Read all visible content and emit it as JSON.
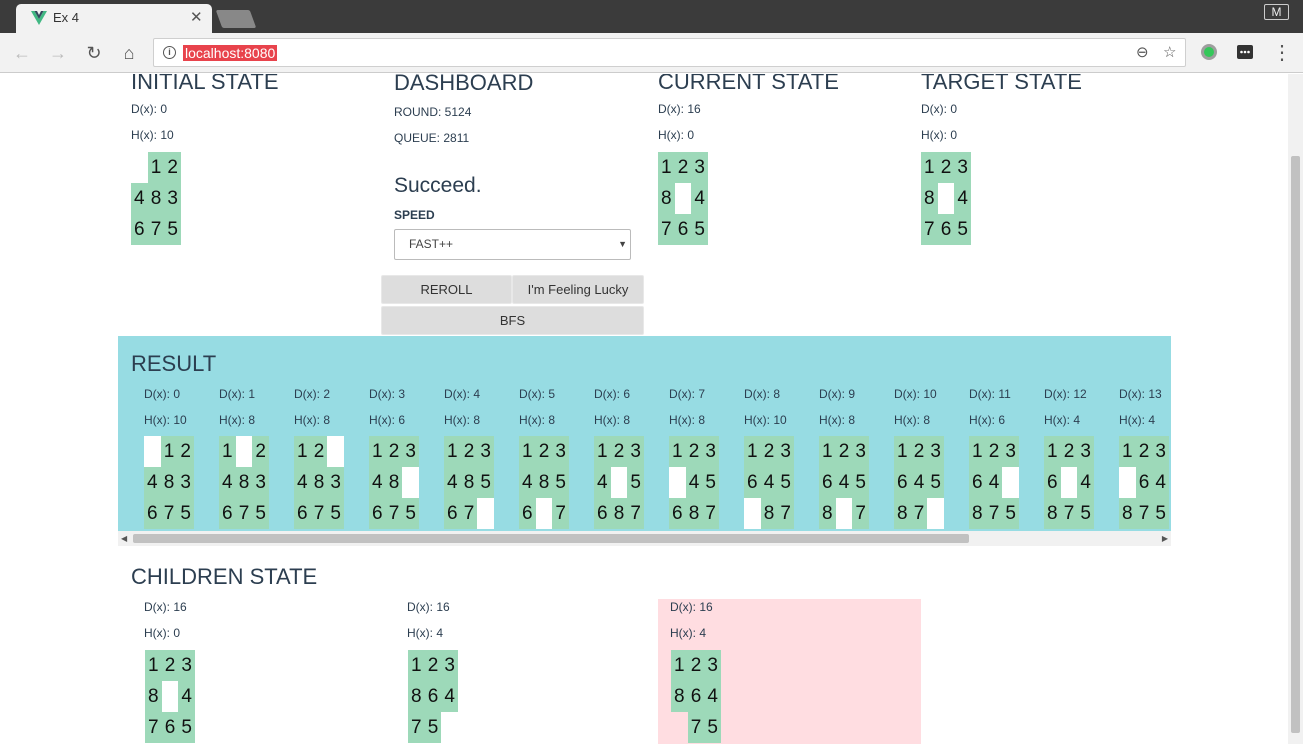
{
  "browser": {
    "tab_title": "Ex 4",
    "tab_close": "✕",
    "url": "localhost:8080",
    "profile": "M",
    "nav": {
      "back": "←",
      "forward": "→",
      "reload": "↻",
      "home": "⌂"
    },
    "omni": {
      "zoom": "⊖",
      "star": "☆"
    },
    "menu": "⋮"
  },
  "initial": {
    "title": "INITIAL STATE",
    "d": "D(x): 0",
    "h": "H(x): 10",
    "board": [
      "",
      "1",
      "2",
      "4",
      "8",
      "3",
      "6",
      "7",
      "5"
    ]
  },
  "dashboard": {
    "title": "DASHBOARD",
    "round": "ROUND: 5124",
    "queue": "QUEUE: 2811",
    "status": "Succeed.",
    "speed_label": "SPEED",
    "speed_value": "FAST++",
    "select_arrow": "▼",
    "reroll": "REROLL",
    "lucky": "I'm Feeling Lucky",
    "bfs": "BFS"
  },
  "current": {
    "title": "CURRENT STATE",
    "d": "D(x): 16",
    "h": "H(x): 0",
    "board": [
      "1",
      "2",
      "3",
      "8",
      "",
      "4",
      "7",
      "6",
      "5"
    ]
  },
  "target": {
    "title": "TARGET STATE",
    "d": "D(x): 0",
    "h": "H(x): 0",
    "board": [
      "1",
      "2",
      "3",
      "8",
      "",
      "4",
      "7",
      "6",
      "5"
    ]
  },
  "result": {
    "title": "RESULT",
    "scroll_left": "◀",
    "scroll_right": "▶",
    "steps": [
      {
        "d": "D(x): 0",
        "h": "H(x): 10",
        "board": [
          "",
          "1",
          "2",
          "4",
          "8",
          "3",
          "6",
          "7",
          "5"
        ]
      },
      {
        "d": "D(x): 1",
        "h": "H(x): 8",
        "board": [
          "1",
          "",
          "2",
          "4",
          "8",
          "3",
          "6",
          "7",
          "5"
        ]
      },
      {
        "d": "D(x): 2",
        "h": "H(x): 8",
        "board": [
          "1",
          "2",
          "",
          "4",
          "8",
          "3",
          "6",
          "7",
          "5"
        ]
      },
      {
        "d": "D(x): 3",
        "h": "H(x): 6",
        "board": [
          "1",
          "2",
          "3",
          "4",
          "8",
          "",
          "6",
          "7",
          "5"
        ]
      },
      {
        "d": "D(x): 4",
        "h": "H(x): 8",
        "board": [
          "1",
          "2",
          "3",
          "4",
          "8",
          "5",
          "6",
          "7",
          ""
        ]
      },
      {
        "d": "D(x): 5",
        "h": "H(x): 8",
        "board": [
          "1",
          "2",
          "3",
          "4",
          "8",
          "5",
          "6",
          "",
          "7"
        ]
      },
      {
        "d": "D(x): 6",
        "h": "H(x): 8",
        "board": [
          "1",
          "2",
          "3",
          "4",
          "",
          "5",
          "6",
          "8",
          "7"
        ]
      },
      {
        "d": "D(x): 7",
        "h": "H(x): 8",
        "board": [
          "1",
          "2",
          "3",
          "",
          "4",
          "5",
          "6",
          "8",
          "7"
        ]
      },
      {
        "d": "D(x): 8",
        "h": "H(x): 10",
        "board": [
          "1",
          "2",
          "3",
          "6",
          "4",
          "5",
          "",
          "8",
          "7"
        ]
      },
      {
        "d": "D(x): 9",
        "h": "H(x): 8",
        "board": [
          "1",
          "2",
          "3",
          "6",
          "4",
          "5",
          "8",
          "",
          "7"
        ]
      },
      {
        "d": "D(x): 10",
        "h": "H(x): 8",
        "board": [
          "1",
          "2",
          "3",
          "6",
          "4",
          "5",
          "8",
          "7",
          ""
        ]
      },
      {
        "d": "D(x): 11",
        "h": "H(x): 6",
        "board": [
          "1",
          "2",
          "3",
          "6",
          "4",
          "",
          "8",
          "7",
          "5"
        ]
      },
      {
        "d": "D(x): 12",
        "h": "H(x): 4",
        "board": [
          "1",
          "2",
          "3",
          "6",
          "",
          "4",
          "8",
          "7",
          "5"
        ]
      },
      {
        "d": "D(x): 13",
        "h": "H(x): 4",
        "board": [
          "1",
          "2",
          "3",
          "",
          "6",
          "4",
          "8",
          "7",
          "5"
        ]
      }
    ]
  },
  "children": {
    "title": "CHILDREN STATE",
    "items": [
      {
        "d": "D(x): 16",
        "h": "H(x): 0",
        "board": [
          "1",
          "2",
          "3",
          "8",
          "",
          "4",
          "7",
          "6",
          "5"
        ],
        "highlight": false
      },
      {
        "d": "D(x): 16",
        "h": "H(x): 4",
        "board": [
          "1",
          "2",
          "3",
          "8",
          "6",
          "4",
          "7",
          "5",
          ""
        ],
        "highlight": false
      },
      {
        "d": "D(x): 16",
        "h": "H(x): 4",
        "board": [
          "1",
          "2",
          "3",
          "8",
          "6",
          "4",
          "",
          "7",
          "5"
        ],
        "highlight": true
      }
    ],
    "colors": {
      "tile": "#9dd9b9",
      "result_bg": "#97dce3",
      "child_highlight": "#ffdde1"
    }
  }
}
